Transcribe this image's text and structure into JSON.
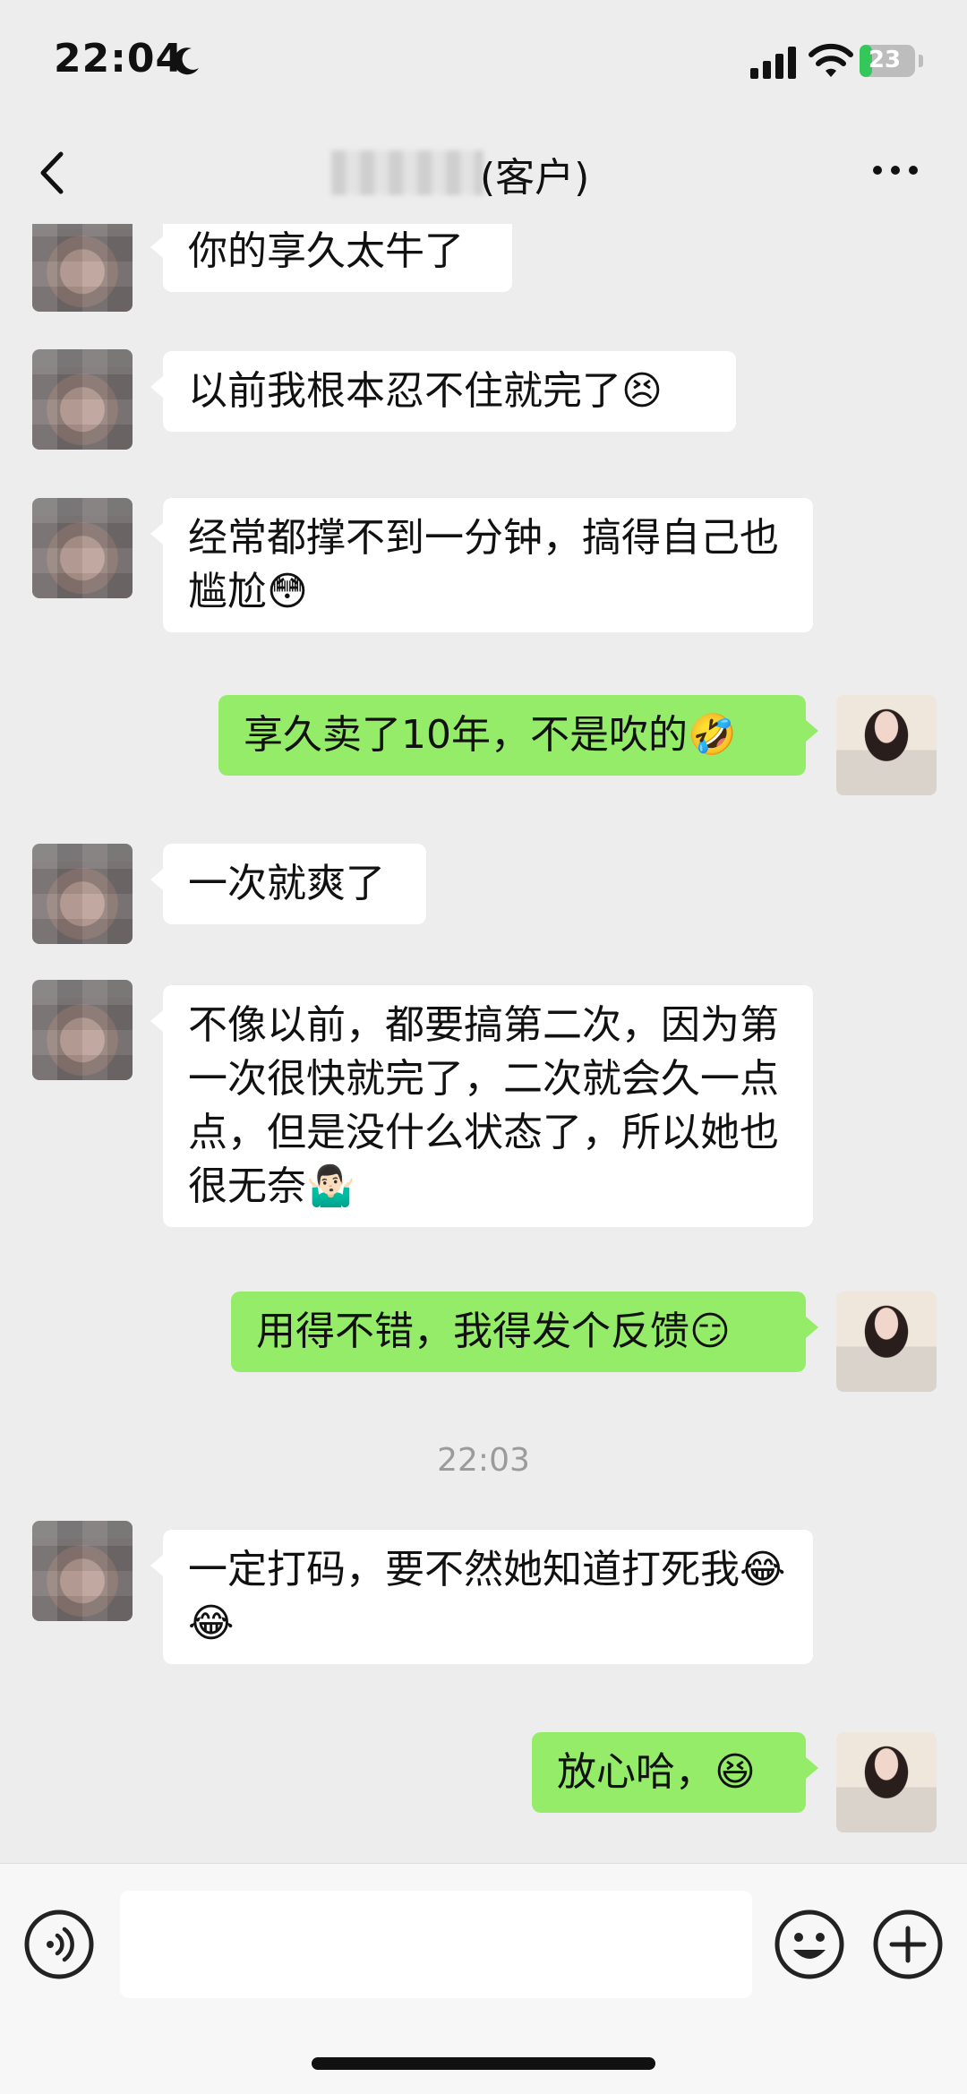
{
  "status_bar": {
    "time": "22:04",
    "battery_level": "23",
    "battery_fraction": 0.23
  },
  "header": {
    "contact_tag": "(客户)"
  },
  "messages": [
    {
      "side": "left",
      "text": "你的享久太牛了"
    },
    {
      "side": "left",
      "text": "以前我根本忍不住就完了😣"
    },
    {
      "side": "left",
      "text": "经常都撑不到一分钟，搞得自己也尴尬😳"
    },
    {
      "side": "right",
      "text": "享久卖了10年，不是吹的🤣"
    },
    {
      "side": "left",
      "text": "一次就爽了"
    },
    {
      "side": "left",
      "text": "不像以前，都要搞第二次，因为第一次很快就完了，二次就会久一点点，但是没什么状态了，所以她也很无奈🤷🏻‍♂️"
    },
    {
      "side": "right",
      "text": "用得不错，我得发个反馈😏"
    },
    {
      "side": "left",
      "text": "一定打码，要不然她知道打死我😂😂"
    },
    {
      "side": "right",
      "text": "放心哈，😆"
    }
  ],
  "time_divider": "22:03",
  "input": {
    "placeholder": ""
  }
}
